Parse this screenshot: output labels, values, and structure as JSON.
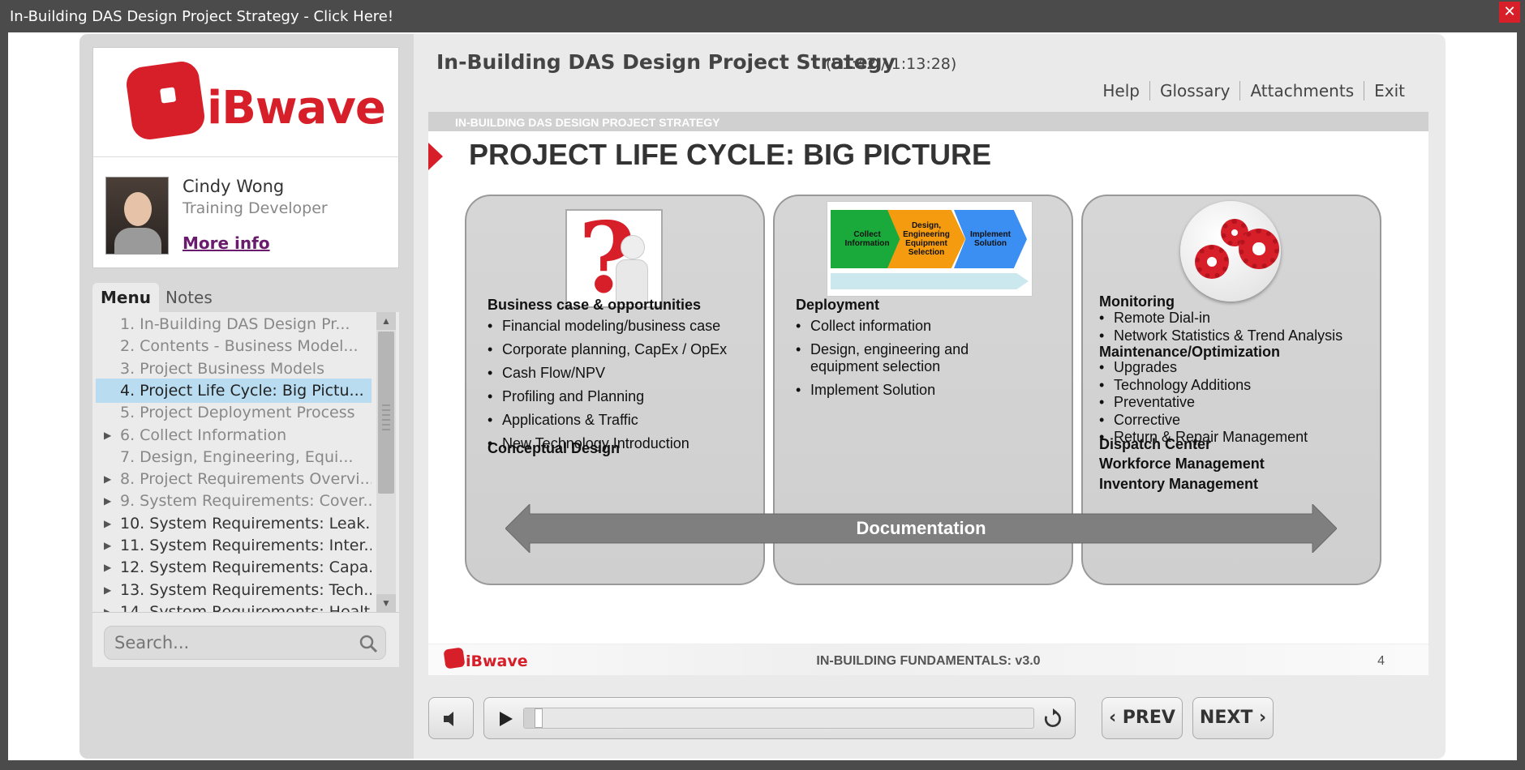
{
  "window": {
    "title": "In-Building DAS Design Project Strategy - Click Here!",
    "close_label": "✕"
  },
  "sidebar": {
    "logo_text": "iBwave",
    "presenter": {
      "name": "Cindy Wong",
      "role": "Training Developer",
      "more_info": "More info"
    },
    "tabs": [
      "Menu",
      "Notes"
    ],
    "menu_items": [
      {
        "label": "1. In-Building DAS Design Pr...",
        "expandable": false,
        "visited": true
      },
      {
        "label": "2. Contents - Business Model...",
        "expandable": false,
        "visited": true
      },
      {
        "label": "3. Project Business Models",
        "expandable": false,
        "visited": true
      },
      {
        "label": "4. Project Life Cycle: Big Pictu...",
        "expandable": false,
        "selected": true
      },
      {
        "label": "5. Project Deployment Process",
        "expandable": false,
        "visited": true
      },
      {
        "label": "6. Collect Information",
        "expandable": true,
        "visited": true
      },
      {
        "label": "7. Design, Engineering, Equi...",
        "expandable": false,
        "visited": true
      },
      {
        "label": "8. Project Requirements Overvi...",
        "expandable": true,
        "visited": true
      },
      {
        "label": "9. System Requirements: Cover...",
        "expandable": true,
        "visited": true
      },
      {
        "label": "10. System Requirements: Leak...",
        "expandable": true,
        "visited": false
      },
      {
        "label": "11. System Requirements: Inter...",
        "expandable": true,
        "visited": false
      },
      {
        "label": "12. System Requirements: Capa...",
        "expandable": true,
        "visited": false
      },
      {
        "label": "13. System Requirements: Tech...",
        "expandable": true,
        "visited": false
      },
      {
        "label": "14. System Requirements: Healt...",
        "expandable": true,
        "visited": false
      }
    ],
    "search": {
      "placeholder": "Search..."
    }
  },
  "header": {
    "title": "In-Building DAS Design Project Strategy",
    "time": "(01:42 / 1:13:28)",
    "links": [
      "Help",
      "Glossary",
      "Attachments",
      "Exit"
    ]
  },
  "slide": {
    "strip": "IN-BUILDING DAS DESIGN PROJECT STRATEGY",
    "heading": "PROJECT LIFE CYCLE: BIG PICTURE",
    "left": {
      "heading": "Business case & opportunities",
      "items": [
        "Financial modeling/business case",
        "Corporate planning, CapEx / OpEx",
        "Cash Flow/NPV",
        "Profiling and Planning",
        "Applications & Traffic",
        "New Technology Introduction"
      ],
      "heading2": "Conceptual Design"
    },
    "middle": {
      "process_steps": [
        "Collect Information",
        "Design, Engineering Equipment Selection",
        "Implement Solution"
      ],
      "heading": "Deployment",
      "items": [
        "Collect information",
        "Design, engineering and equipment selection",
        "Implement Solution"
      ]
    },
    "right": {
      "heading1": "Monitoring",
      "items1": [
        "Remote Dial-in",
        "Network Statistics & Trend Analysis"
      ],
      "heading2": "Maintenance/Optimization",
      "items2": [
        "Upgrades",
        "Technology Additions",
        "Preventative",
        "Corrective",
        "Return & Repair Management"
      ],
      "heading3": "Dispatch Center",
      "heading4": "Workforce Management",
      "heading5": "Inventory Management"
    },
    "arrow_label": "Documentation",
    "footer": {
      "logo": "iBwave",
      "center": "IN-BUILDING FUNDAMENTALS: v3.0",
      "page": "4"
    }
  },
  "controls": {
    "prev": "PREV",
    "next": "NEXT",
    "progress": 0.02
  },
  "colors": {
    "brand_red": "#d71f2a",
    "selected_item": "#b9dcf0",
    "link_purple": "#6a1b6e"
  }
}
